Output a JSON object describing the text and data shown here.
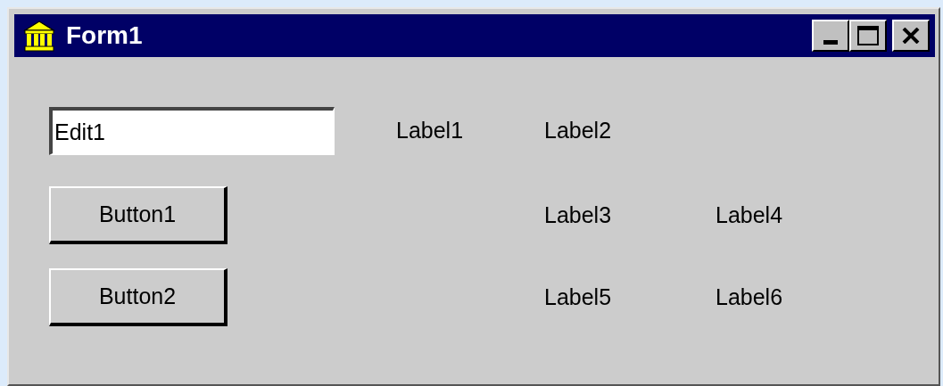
{
  "window": {
    "title": "Form1"
  },
  "rows": [
    {
      "control": {
        "kind": "edit",
        "value": "Edit1"
      },
      "labels": [
        "Label1",
        "Label2"
      ]
    },
    {
      "control": {
        "kind": "button",
        "label": "Button1"
      },
      "labels": [
        "Label3",
        "Label4"
      ]
    },
    {
      "control": {
        "kind": "button",
        "label": "Button2"
      },
      "labels": [
        "Label5",
        "Label6"
      ]
    }
  ]
}
